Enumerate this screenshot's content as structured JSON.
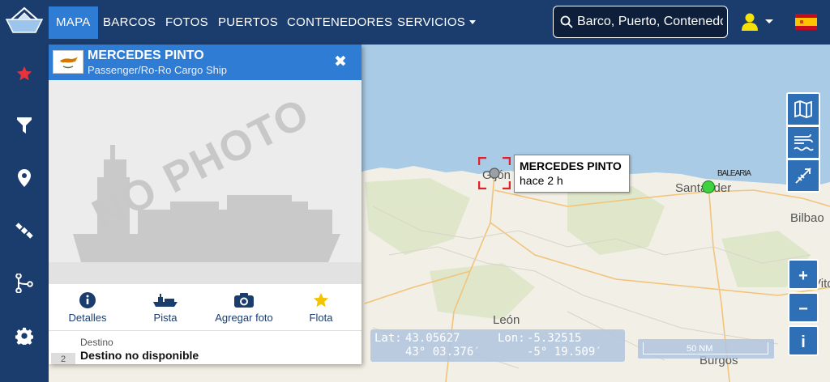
{
  "nav": {
    "items": [
      "MAPA",
      "BARCOS",
      "FOTOS",
      "PUERTOS",
      "CONTENEDORES",
      "SERVICIOS"
    ],
    "active": "MAPA"
  },
  "search": {
    "placeholder": "Barco, Puerto, Contenedor"
  },
  "sidebar": {
    "items": [
      "favorites-icon",
      "filter-icon",
      "location-pin-icon",
      "satellite-icon",
      "route-icon",
      "settings-icon"
    ]
  },
  "vessel": {
    "name": "MERCEDES PINTO",
    "type": "Passenger/Ro-Ro Cargo Ship",
    "photo_placeholder": "NO PHOTO",
    "actions": [
      "Detalles",
      "Pista",
      "Agregar foto",
      "Flota"
    ],
    "destination_label": "Destino",
    "destination_value": "Destino no disponible",
    "badge": "2"
  },
  "tooltip": {
    "name": "MERCEDES PINTO",
    "time": "hace 2 h"
  },
  "map": {
    "cities": {
      "gijon": "Gijón",
      "santander": "Santander",
      "bilbao": "Bilbao",
      "leon": "León",
      "vitoria": "Vitoria",
      "burgos": "Burgos"
    },
    "clutter_text": "BALEARIA",
    "colors": {
      "sea": "#a9cbe6",
      "land": "#f2efe6",
      "accent": "#2f7cd5",
      "nav": "#1b3d6e"
    }
  },
  "coords": {
    "lat_label": "Lat:",
    "lat_dec": "43.05627",
    "lon_label": "Lon:",
    "lon_dec": "-5.32515",
    "lat_dms": "43° 03.376′",
    "lon_dms": "-5° 19.509′"
  },
  "scale": {
    "label": "50 NM"
  },
  "controls": {
    "plus": "+",
    "minus": "−",
    "info": "i"
  }
}
